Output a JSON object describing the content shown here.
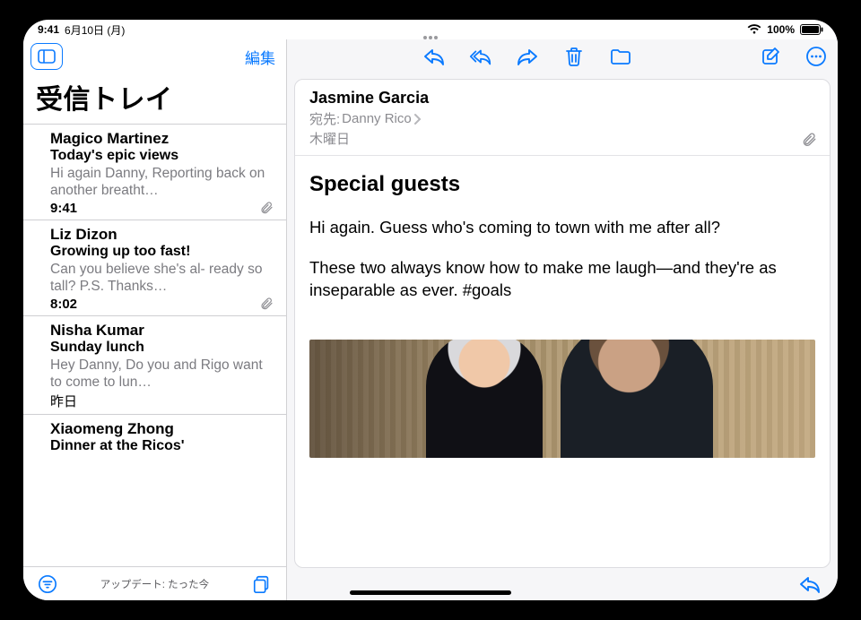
{
  "status": {
    "time": "9:41",
    "date": "6月10日 (月)",
    "battery_pct": "100%"
  },
  "sidebar": {
    "edit_label": "編集",
    "title": "受信トレイ",
    "update_text": "アップデート: たった今",
    "messages": [
      {
        "sender": "Magico Martinez",
        "subject": "Today's epic views",
        "preview": "Hi again Danny, Reporting back on another breatht…",
        "time": "9:41",
        "has_attachment": true
      },
      {
        "sender": "Liz Dizon",
        "subject": "Growing up too fast!",
        "preview": "Can you believe she's al-\nready so tall? P.S. Thanks…",
        "time": "8:02",
        "has_attachment": true
      },
      {
        "sender": "Nisha Kumar",
        "subject": "Sunday lunch",
        "preview": "Hey Danny, Do you and Rigo want to come to lun…",
        "time": "昨日",
        "has_attachment": false
      },
      {
        "sender": "Xiaomeng Zhong",
        "subject": "Dinner at the Ricos'",
        "preview": "",
        "time": "",
        "has_attachment": false
      }
    ]
  },
  "mail": {
    "from": "Jasmine Garcia",
    "to_label": "宛先:",
    "to_name": "Danny Rico",
    "date": "木曜日",
    "subject": "Special guests",
    "paragraphs": [
      "Hi again. Guess who's coming to town with me after all?",
      "These two always know how to make me laugh—and they're as inseparable as ever. #goals"
    ]
  },
  "icons": {
    "sidebar_toggle": "sidebar-toggle-icon",
    "reply": "reply-icon",
    "reply_all": "reply-all-icon",
    "forward": "forward-icon",
    "trash": "trash-icon",
    "move": "move-folder-icon",
    "compose": "compose-icon",
    "more": "more-icon",
    "filter": "filter-icon",
    "folders": "folders-stack-icon",
    "attachment": "paperclip-icon",
    "chevron": "chevron-right-icon",
    "wifi": "wifi-icon",
    "battery": "battery-icon"
  },
  "colors": {
    "accent": "#0a7aff"
  }
}
